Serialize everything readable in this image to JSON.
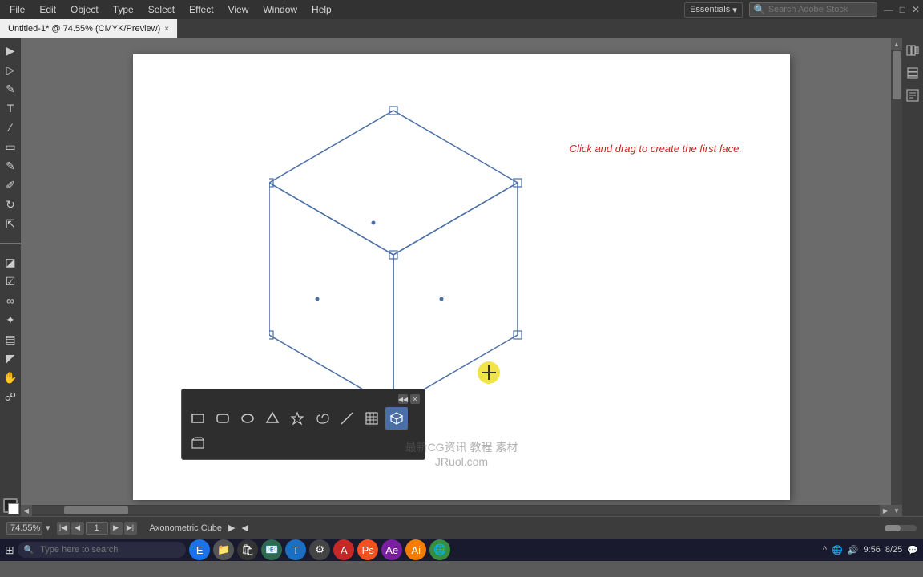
{
  "menubar": {
    "items": [
      "File",
      "Edit",
      "Object",
      "Type",
      "Select",
      "Effect",
      "View",
      "Window",
      "Help"
    ],
    "workspace": "Essentials",
    "search_placeholder": "Search Adobe Stock"
  },
  "tab": {
    "title": "Untitled-1* @ 74.55% (CMYK/Preview)",
    "close": "×"
  },
  "canvas": {
    "hint": "Click and drag to create the first face.",
    "watermark_line1": "最新CG资讯 教程 素材",
    "watermark_line2": "JRuol.com"
  },
  "bottom_bar": {
    "zoom": "74.55%",
    "zoom_dropdown": "▾",
    "page": "1",
    "artboard_name": "Axonometric Cube"
  },
  "taskbar": {
    "search_placeholder": "Type here to search",
    "time": "9:56",
    "date": "8/25"
  },
  "float_toolbar": {
    "title": "◀◀",
    "close": "×",
    "tools": [
      {
        "name": "rect-tool",
        "icon": "▭"
      },
      {
        "name": "rounded-rect-tool",
        "icon": "▢"
      },
      {
        "name": "ellipse-tool",
        "icon": "○"
      },
      {
        "name": "polygon-tool",
        "icon": "△"
      },
      {
        "name": "star-tool",
        "icon": "✦"
      },
      {
        "name": "spiral-tool",
        "icon": "◎"
      },
      {
        "name": "line-tool",
        "icon": "╱"
      },
      {
        "name": "grid-tool",
        "icon": "⊞"
      },
      {
        "name": "cube-tool",
        "icon": "⬡",
        "active": true
      },
      {
        "name": "perspective-tool",
        "icon": "⬜"
      }
    ]
  },
  "right_panel": {
    "icons": [
      "≡",
      "☰",
      "⬜"
    ]
  },
  "colors": {
    "cube_stroke": "#4a6fa5",
    "cursor_bg": "#f0e44a",
    "hint_color": "#cc2222",
    "canvas_bg": "#ffffff",
    "app_bg": "#6b6b6b"
  }
}
